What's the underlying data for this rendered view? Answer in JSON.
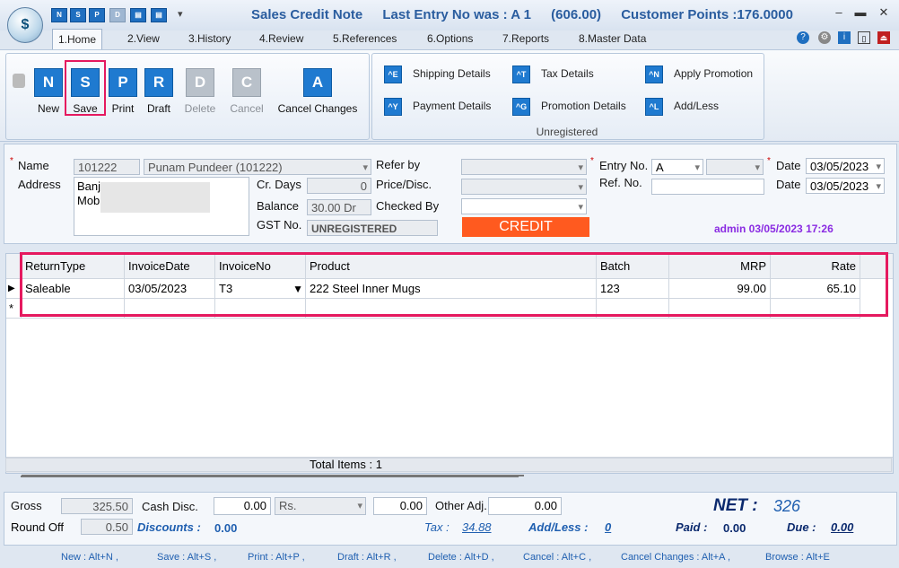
{
  "window": {
    "title": "Sales Credit Note",
    "last_entry": "Last Entry No was : A 1",
    "last_amount": "(606.00)",
    "customer_points": "Customer Points :176.0000"
  },
  "tabs": [
    "1.Home",
    "2.View",
    "3.History",
    "4.Review",
    "5.References",
    "6.Options",
    "7.Reports",
    "8.Master Data"
  ],
  "ribbon": {
    "buttons": [
      {
        "label": "New",
        "icon": "N"
      },
      {
        "label": "Save",
        "icon": "S"
      },
      {
        "label": "Print",
        "icon": "P"
      },
      {
        "label": "Draft",
        "icon": "R"
      },
      {
        "label": "Delete",
        "icon": "D"
      },
      {
        "label": "Cancel",
        "icon": "C"
      },
      {
        "label": "Cancel Changes",
        "icon": "A"
      }
    ],
    "side": [
      {
        "label": "Shipping Details",
        "icon": "^E"
      },
      {
        "label": "Tax Details",
        "icon": "^T"
      },
      {
        "label": "Apply Promotion",
        "icon": "^N"
      },
      {
        "label": "Payment Details",
        "icon": "^Y"
      },
      {
        "label": "Promotion Details",
        "icon": "^G"
      },
      {
        "label": "Add/Less",
        "icon": "^L"
      }
    ],
    "group_caption": "Unregistered"
  },
  "form": {
    "name_label": "Name",
    "name_code": "101222",
    "name_value": "Punam Pundeer (101222)",
    "address_label": "Address",
    "address_line1": "Banj",
    "address_line2": "Mob",
    "crdays_label": "Cr. Days",
    "crdays_value": "0",
    "balance_label": "Balance",
    "balance_value": "30.00 Dr",
    "gst_label": "GST No.",
    "gst_value": "UNREGISTERED",
    "referby_label": "Refer by",
    "pricedisc_label": "Price/Disc.",
    "checkedby_label": "Checked By",
    "credit_label": "CREDIT",
    "entry_label": "Entry No.",
    "entry_value": "A",
    "refno_label": "Ref. No.",
    "date_label": "Date",
    "date1": "03/05/2023",
    "date2": "03/05/2023",
    "user_stamp": "admin 03/05/2023 17:26"
  },
  "grid": {
    "columns": [
      "ReturnType",
      "InvoiceDate",
      "InvoiceNo",
      "Product",
      "Batch",
      "MRP",
      "Rate"
    ],
    "rows": [
      [
        "Saleable",
        "03/05/2023",
        "T3",
        "222 Steel Inner Mugs",
        "123",
        "99.00",
        "65.10"
      ]
    ],
    "total_items": "Total Items : 1"
  },
  "footer": {
    "gross_label": "Gross",
    "gross_value": "325.50",
    "cashdisc_label": "Cash Disc.",
    "cashdisc_value": "0.00",
    "cashdisc_unit": "Rs.",
    "cashdisc_amount": "0.00",
    "otheradj_label": "Other Adj.",
    "otheradj_value": "0.00",
    "roundoff_label": "Round Off",
    "roundoff_value": "0.50",
    "discounts_label": "Discounts :",
    "discounts_value": "0.00",
    "tax_label": "Tax :",
    "tax_value": "34.88",
    "addless_label": "Add/Less :",
    "addless_value": "0",
    "net_label": "NET :",
    "net_value": "326",
    "paid_label": "Paid :",
    "paid_value": "0.00",
    "due_label": "Due :",
    "due_value": "0.00"
  },
  "shortcuts": [
    "New : Alt+N ,",
    "Save : Alt+S ,",
    "Print : Alt+P ,",
    "Draft : Alt+R ,",
    "Delete : Alt+D ,",
    "Cancel : Alt+C ,",
    "Cancel Changes : Alt+A ,",
    "Browse : Alt+E"
  ],
  "colors": {
    "highlight": "#e5195f",
    "credit": "#ff5a1f",
    "title": "#2a5d9f",
    "accent_blue": "#1f7ad0"
  }
}
